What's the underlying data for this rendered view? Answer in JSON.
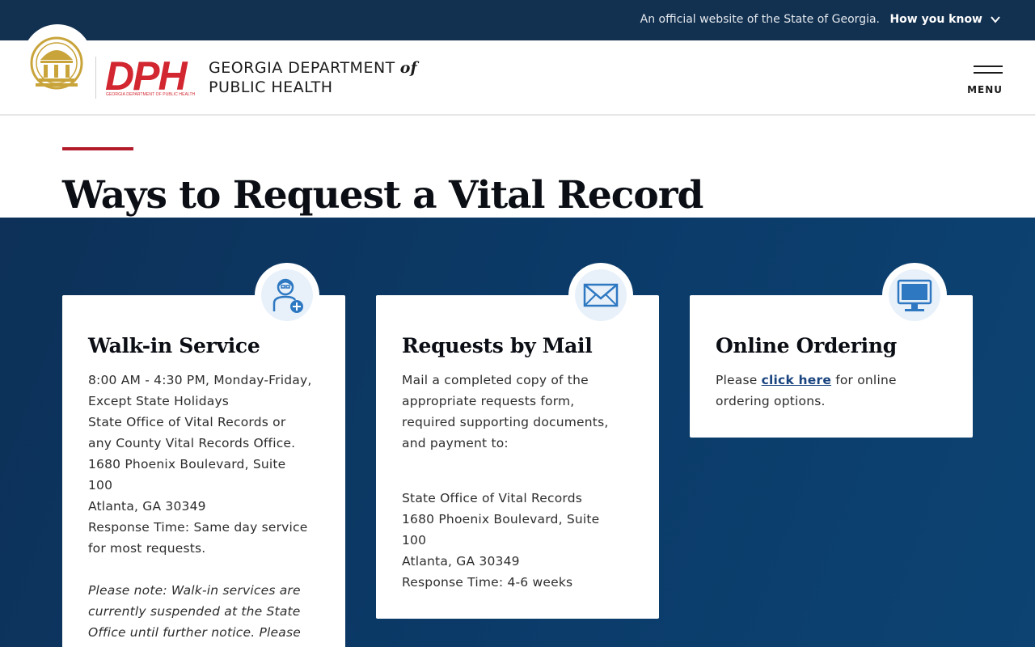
{
  "gov_banner": {
    "official_text": "An official website of the State of Georgia.",
    "how_you_know": "How you know"
  },
  "header": {
    "logo_letters": "DPH",
    "logo_subtext": "GEORGIA DEPARTMENT OF PUBLIC HEALTH",
    "agency_line1": "GEORGIA DEPARTMENT",
    "agency_of": "of",
    "agency_line2": "PUBLIC HEALTH",
    "menu_label": "MENU"
  },
  "page": {
    "title": "Ways to Request a Vital Record"
  },
  "cards": [
    {
      "icon": "person-medical-icon",
      "title": "Walk-in Service",
      "lines": [
        "8:00 AM - 4:30 PM, Monday-Friday,",
        "Except State Holidays",
        "State Office of Vital Records or",
        "any County Vital Records Office.",
        "1680 Phoenix Boulevard, Suite",
        "100",
        "Atlanta, GA 30349",
        "Response Time: Same day service",
        "for most requests."
      ],
      "note_lines": [
        "Please note: Walk-in services are",
        "currently suspended at the State",
        "Office until further notice. Please"
      ]
    },
    {
      "icon": "envelope-icon",
      "title": "Requests by Mail",
      "lines": [
        "Mail a completed copy of the",
        "appropriate requests form,",
        "required supporting documents,",
        "and payment to:"
      ],
      "address_lines": [
        "State Office of Vital Records",
        "1680 Phoenix Boulevard, Suite",
        "100",
        "Atlanta, GA 30349",
        "Response Time: 4-6 weeks"
      ]
    },
    {
      "icon": "computer-monitor-icon",
      "title": "Online Ordering",
      "text_before": "Please ",
      "link_text": "click here",
      "text_after": " for online",
      "line2": "ordering options."
    }
  ],
  "colors": {
    "banner_bg": "#12304f",
    "section_bg": "#0b3a68",
    "accent_red": "#b31b2b",
    "logo_red": "#d22630",
    "seal_gold": "#c9a43b",
    "icon_blue": "#2e78c2",
    "link_blue": "#1a4480"
  }
}
